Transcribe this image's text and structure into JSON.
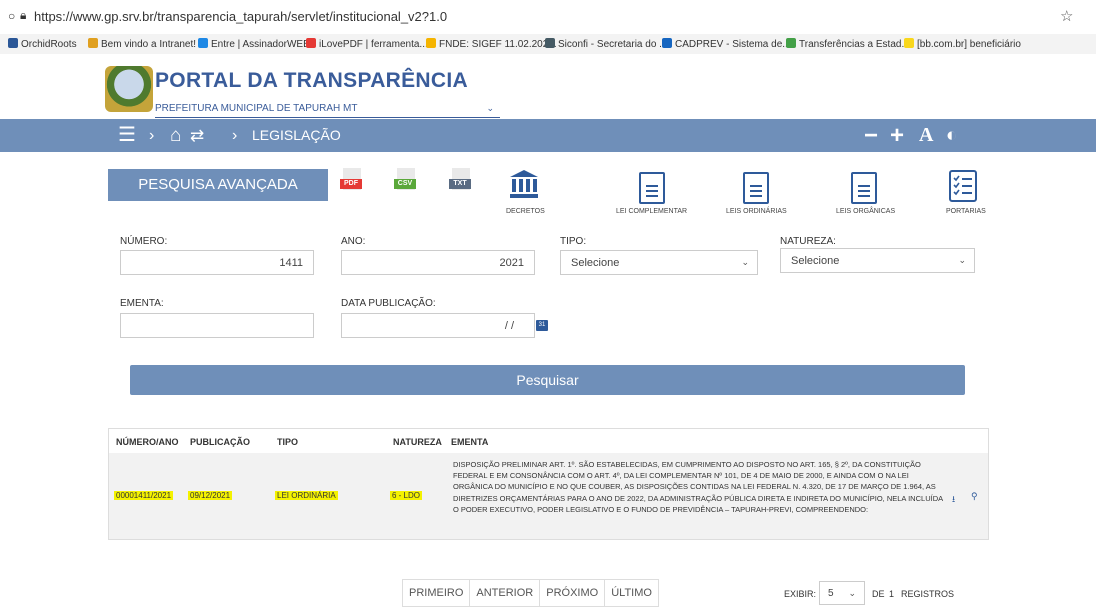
{
  "browser": {
    "url": "https://www.gp.srv.br/transparencia_tapurah/servlet/institucional_v2?1.0",
    "bookmarks": [
      {
        "label": "OrchidRoots",
        "color": "#2b5797"
      },
      {
        "label": "Bem vindo a Intranet!",
        "color": "#e0a020"
      },
      {
        "label": "Entre | AssinadorWEB",
        "color": "#1e88e5"
      },
      {
        "label": "iLovePDF | ferramenta...",
        "color": "#e53935"
      },
      {
        "label": "FNDE: SIGEF 11.02.202...",
        "color": "#f5b400"
      },
      {
        "label": "Siconfi - Secretaria do ...",
        "color": "#455a64"
      },
      {
        "label": "CADPREV - Sistema de...",
        "color": "#1565c0"
      },
      {
        "label": "Transferências a Estad...",
        "color": "#43a047"
      },
      {
        "label": "[bb.com.br] beneficiário",
        "color": "#f9d71c"
      }
    ]
  },
  "header": {
    "title": "PORTAL DA TRANSPARÊNCIA",
    "entity_select": "PREFEITURA MUNICIPAL DE TAPURAH MT"
  },
  "nav": {
    "breadcrumb_current": "LEGISLAÇÃO",
    "accessibility": [
      "−",
      "+",
      "A",
      "◐"
    ]
  },
  "toolbar": {
    "advanced_search": "PESQUISA AVANÇADA",
    "exports": [
      {
        "label": "PDF",
        "color": "#e53935"
      },
      {
        "label": "CSV",
        "color": "#5aa83a"
      },
      {
        "label": "TXT",
        "color": "#5a6b82"
      }
    ],
    "categories": {
      "decretos": "DECRETOS",
      "lei_complementar": "LEI COMPLEMENTAR",
      "leis_ordinarias": "LEIS ORDINÁRIAS",
      "leis_organicas": "LEIS ORGÂNICAS",
      "portarias": "PORTARIAS"
    }
  },
  "form": {
    "numero_label": "NÚMERO:",
    "numero_value": "1411",
    "ano_label": "ANO:",
    "ano_value": "2021",
    "tipo_label": "TIPO:",
    "tipo_value": "Selecione",
    "natureza_label": "NATUREZA:",
    "natureza_value": "Selecione",
    "ementa_label": "EMENTA:",
    "ementa_value": "",
    "data_label": "DATA PUBLICAÇÃO:",
    "data_value": "/ /",
    "calendar_label": "31",
    "search_button": "Pesquisar"
  },
  "table": {
    "headers": [
      "NÚMERO/ANO",
      "PUBLICAÇÃO",
      "TIPO",
      "NATUREZA",
      "EMENTA"
    ],
    "row": {
      "numero_ano": "00001411/2021",
      "publicacao": "09/12/2021",
      "tipo": "LEI ORDINÁRIA",
      "natureza": "6 - LDO",
      "ementa": "DISPOSIÇÃO PRELIMINAR ART. 1º. SÃO ESTABELECIDAS, EM CUMPRIMENTO AO DISPOSTO NO ART. 165, § 2º, DA CONSTITUIÇÃO FEDERAL E EM CONSONÂNCIA COM O ART. 4º, DA LEI COMPLEMENTAR Nº 101, DE 4 DE MAIO DE 2000, E AINDA COM O NA LEI ORGÂNICA DO MUNICÍPIO E NO QUE COUBER, AS DISPOSIÇÕES CONTIDAS NA LEI FEDERAL N. 4.320, DE 17 DE MARÇO DE 1.964, AS DIRETRIZES ORÇAMENTÁRIAS PARA O ANO DE 2022, DA ADMINISTRAÇÃO PÚBLICA DIRETA E INDIRETA DO MUNICÍPIO, NELA INCLUÍDA O PODER EXECUTIVO, PODER LEGISLATIVO E O FUNDO DE PREVIDÊNCIA – TAPURAH-PREVI, COMPREENDENDO:"
    }
  },
  "pagination": {
    "first": "PRIMEIRO",
    "prev": "ANTERIOR",
    "next": "PRÓXIMO",
    "last": "ÚLTIMO",
    "exibir_label": "EXIBIR:",
    "exibir_value": "5",
    "de_label": "DE",
    "total": "1",
    "registros_label": "REGISTROS"
  }
}
